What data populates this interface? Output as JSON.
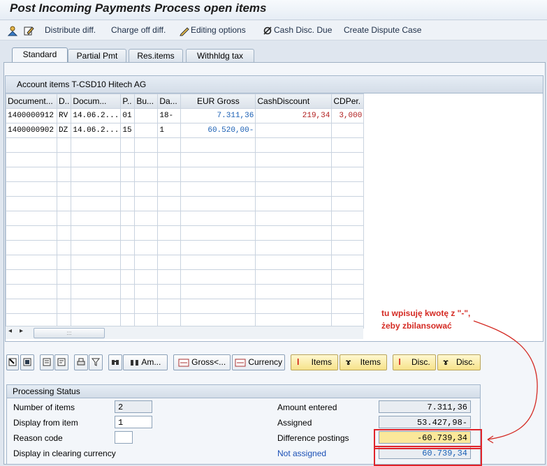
{
  "window": {
    "title": "Post Incoming Payments Process open items"
  },
  "toolbar": {
    "distribute": "Distribute diff.",
    "chargeoff": "Charge off diff.",
    "editing": "Editing options",
    "cashdisc": "Cash Disc. Due",
    "dispute": "Create Dispute Case"
  },
  "tabs": [
    "Standard",
    "Partial Pmt",
    "Res.items",
    "Withhldg tax"
  ],
  "account_items": {
    "title": "Account items T-CSD10 Hitech AG",
    "columns": [
      "Document...",
      "D..",
      "Docum...",
      "P..",
      "Bu...",
      "Da...",
      "EUR Gross",
      "CashDiscount",
      "CDPer."
    ],
    "rows": [
      [
        "1400000912",
        "RV",
        "14.06.2...",
        "01",
        "",
        "18-",
        "7.311,36",
        "219,34",
        "3,000"
      ],
      [
        "1400000902",
        "DZ",
        "14.06.2...",
        "15",
        "",
        "1",
        "60.520,00-",
        "",
        ""
      ]
    ],
    "scroll_grip": ":::"
  },
  "buttons": {
    "am": "Am...",
    "gross": "Gross<...",
    "currency": "Currency",
    "items1": "Items",
    "items2": "Items",
    "disc1": "Disc.",
    "disc2": "Disc."
  },
  "processing_status": {
    "title": "Processing Status",
    "number_of_items_label": "Number of items",
    "number_of_items": "2",
    "display_from_label": "Display from item",
    "display_from": "1",
    "reason_code_label": "Reason code",
    "reason_code": "",
    "display_clearing_label": "Display in clearing currency",
    "amount_entered_label": "Amount entered",
    "amount_entered": "7.311,36",
    "assigned_label": "Assigned",
    "assigned": "53.427,98-",
    "difference_label": "Difference postings",
    "difference": "-60.739,34",
    "not_assigned_label": "Not assigned",
    "not_assigned": "60.739,34"
  },
  "annotation": {
    "line1": "tu wpisuję kwotę z \"-\",",
    "line2": "żeby zbilansować",
    "color": "#d42a23"
  }
}
